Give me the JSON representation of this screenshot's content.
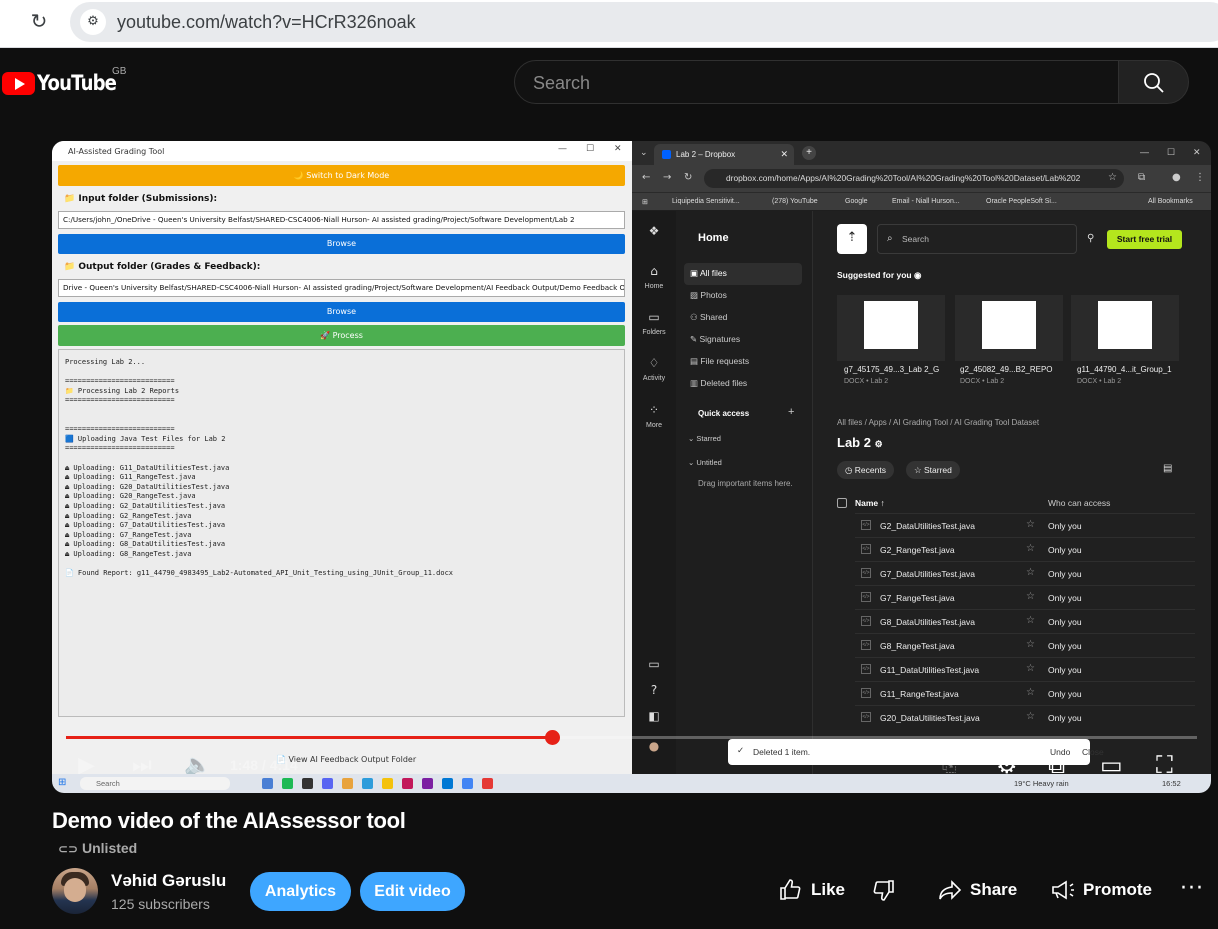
{
  "browser": {
    "url": "youtube.com/watch?v=HCrR326noak"
  },
  "youtube": {
    "logo_text": "YouTube",
    "country": "GB",
    "search_placeholder": "Search"
  },
  "app": {
    "window_title": "AI-Assisted Grading Tool",
    "dark_mode_button": "🌙 Switch to Dark Mode",
    "input_label": "📁 Input folder (Submissions):",
    "input_path": "C:/Users/john_/OneDrive - Queen's University Belfast/SHARED-CSC4006-Niall Hurson- AI assisted grading/Project/Software Development/Lab 2",
    "browse_label": "Browse",
    "output_label": "📁 Output folder (Grades & Feedback):",
    "output_path": "Drive - Queen's University Belfast/SHARED-CSC4006-Niall Hurson- AI assisted grading/Project/Software Development/AI Feedback Output/Demo Feedback Output",
    "process_label": "🚀 Process",
    "log_lines": [
      "Processing Lab 2...",
      "",
      "==========================",
      "📁 Processing Lab 2 Reports",
      "==========================",
      "",
      "",
      "==========================",
      "🟦 Uploading Java Test Files for Lab 2",
      "==========================",
      "",
      "⏏ Uploading: G11_DataUtilitiesTest.java",
      "⏏ Uploading: G11_RangeTest.java",
      "⏏ Uploading: G20_DataUtilitiesTest.java",
      "⏏ Uploading: G20_RangeTest.java",
      "⏏ Uploading: G2_DataUtilitiesTest.java",
      "⏏ Uploading: G2_RangeTest.java",
      "⏏ Uploading: G7_DataUtilitiesTest.java",
      "⏏ Uploading: G7_RangeTest.java",
      "⏏ Uploading: G8_DataUtilitiesTest.java",
      "⏏ Uploading: G8_RangeTest.java",
      "",
      "📄 Found Report: g11_44790_4983495_Lab2-Automated_API_Unit_Testing_using_JUnit_Group_11.docx"
    ],
    "footer_link": "📄 View AI Feedback Output Folder"
  },
  "dropbox": {
    "tab_title": "Lab 2 – Dropbox",
    "address": "dropbox.com/home/Apps/AI%20Grading%20Tool/AI%20Grading%20Tool%20Dataset/Lab%202",
    "bookmarks": [
      "Liquipedia Sensitivit...",
      "(278) YouTube",
      "Google",
      "Email - Niall Hurson...",
      "Oracle PeopleSoft Si...",
      "All Bookmarks"
    ],
    "side_icons": [
      "Home",
      "Folders",
      "Activity",
      "More"
    ],
    "panel_title": "Home",
    "panel_items": [
      "All files",
      "Photos",
      "Shared",
      "Signatures",
      "File requests",
      "Deleted files"
    ],
    "quick_access": "Quick access",
    "starred": "Starred",
    "untitled": "Untitled",
    "drag_hint": "Drag important items here.",
    "search_placeholder": "Search",
    "trial_button": "Start free trial",
    "suggested_title": "Suggested for you",
    "suggested": [
      {
        "name": "g7_45175_49...3_Lab 2_G",
        "sub": "DOCX • Lab 2"
      },
      {
        "name": "g2_45082_49...B2_REPO",
        "sub": "DOCX • Lab 2"
      },
      {
        "name": "g11_44790_4...it_Group_1",
        "sub": "DOCX • Lab 2"
      }
    ],
    "breadcrumb": "All files  /  Apps  /  AI Grading Tool  /  AI Grading Tool Dataset",
    "folder_title": "Lab 2",
    "recents": "Recents",
    "starred_pill": "Starred",
    "col_name": "Name",
    "col_access": "Who can access",
    "files": [
      {
        "name": "G2_DataUtilitiesTest.java",
        "access": "Only you"
      },
      {
        "name": "G2_RangeTest.java",
        "access": "Only you"
      },
      {
        "name": "G7_DataUtilitiesTest.java",
        "access": "Only you"
      },
      {
        "name": "G7_RangeTest.java",
        "access": "Only you"
      },
      {
        "name": "G8_DataUtilitiesTest.java",
        "access": "Only you"
      },
      {
        "name": "G8_RangeTest.java",
        "access": "Only you"
      },
      {
        "name": "G11_DataUtilitiesTest.java",
        "access": "Only you"
      },
      {
        "name": "G11_RangeTest.java",
        "access": "Only you"
      },
      {
        "name": "G20_DataUtilitiesTest.java",
        "access": "Only you"
      }
    ],
    "toast_text": "Deleted 1 item.",
    "toast_undo": "Undo",
    "toast_close": "Close"
  },
  "player": {
    "timecode": "1:48 / 4:14",
    "progress": 0.43
  },
  "taskbar": {
    "search": "Search",
    "weather": "19°C   Heavy rain",
    "time": "16:52"
  },
  "video": {
    "title": "Demo video of the AIAssessor tool",
    "visibility": "Unlisted",
    "channel": "Vəhid Gəruslu",
    "subscribers": "125 subscribers",
    "analytics": "Analytics",
    "edit": "Edit video",
    "like": "Like",
    "share": "Share",
    "promote": "Promote"
  },
  "colors": {
    "accent_blue": "#3ea6ff",
    "youtube_red": "#ff0000",
    "dropbox_trial": "#b4e61d"
  }
}
